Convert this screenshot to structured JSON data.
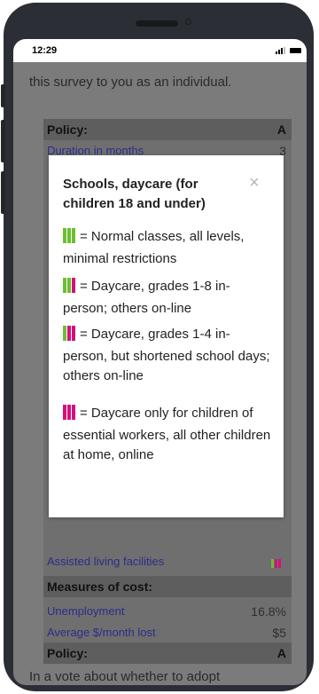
{
  "status_bar": {
    "time": "12:29"
  },
  "intro_text": "this survey to you as an individual.",
  "table": {
    "policy_label": "Policy:",
    "policy_value": "A",
    "duration_label": "Duration in months",
    "duration_value": "3",
    "assisted_label": "Assisted living facilities",
    "cost_header": "Measures of cost:",
    "unemployment_label": "Unemployment",
    "unemployment_value": "16.8%",
    "avg_lost_label": "Average $/month lost",
    "avg_lost_value": "$5",
    "policy_label_bottom": "Policy:",
    "policy_value_bottom": "A"
  },
  "vote_text": "In a vote about whether to adopt",
  "dialog": {
    "title": "Schools, daycare (for children 18 and under)",
    "close": "×",
    "entries": [
      {
        "text": "= Normal classes, all levels, minimal restrictions",
        "bars": [
          "g",
          "g",
          "g"
        ]
      },
      {
        "text": "= Daycare, grades 1-8 in-person; others on-line",
        "bars": [
          "g",
          "g",
          "m"
        ]
      },
      {
        "text": "= Daycare, grades 1-4 in-person, but shortened school days; others on-line",
        "bars": [
          "g",
          "m",
          "m"
        ]
      },
      {
        "text": "= Daycare only for children of essential workers, all other children at home, online",
        "bars": [
          "m",
          "m",
          "m"
        ]
      }
    ]
  },
  "colors": {
    "green": "#6abf2e",
    "magenta": "#d4117b"
  }
}
